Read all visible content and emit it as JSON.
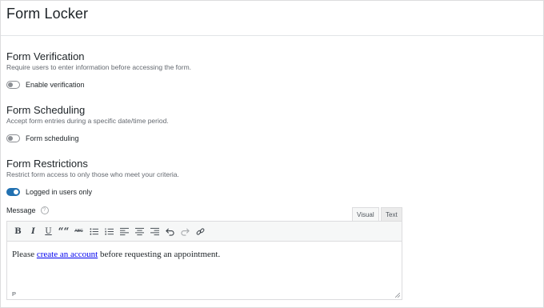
{
  "page": {
    "title": "Form Locker"
  },
  "sections": [
    {
      "title": "Form Verification",
      "description": "Require users to enter information before accessing the form.",
      "toggle_label": "Enable verification",
      "toggle_on": false
    },
    {
      "title": "Form Scheduling",
      "description": "Accept form entries during a specific date/time period.",
      "toggle_label": "Form scheduling",
      "toggle_on": false
    },
    {
      "title": "Form Restrictions",
      "description": "Restrict form access to only those who meet your criteria.",
      "toggle_label": "Logged in users only",
      "toggle_on": true
    }
  ],
  "message": {
    "label": "Message",
    "help_glyph": "?",
    "tabs": {
      "visual": "Visual",
      "text": "Text"
    },
    "toolbar": [
      {
        "name": "bold-icon",
        "glyph": "B"
      },
      {
        "name": "italic-icon",
        "glyph": "I"
      },
      {
        "name": "underline-icon",
        "glyph": "U"
      },
      {
        "name": "blockquote-icon",
        "glyph": "““"
      },
      {
        "name": "strikethrough-icon",
        "glyph": "ABC"
      },
      {
        "name": "bullet-list-icon",
        "glyph": ""
      },
      {
        "name": "numbered-list-icon",
        "glyph": ""
      },
      {
        "name": "align-left-icon",
        "glyph": ""
      },
      {
        "name": "align-center-icon",
        "glyph": ""
      },
      {
        "name": "align-right-icon",
        "glyph": ""
      },
      {
        "name": "undo-icon",
        "glyph": ""
      },
      {
        "name": "redo-icon",
        "glyph": ""
      },
      {
        "name": "link-icon",
        "glyph": ""
      }
    ],
    "content": {
      "before": "Please ",
      "link_text": "create an account",
      "after": " before requesting an appointment."
    },
    "status_path": "P"
  },
  "colors": {
    "accent": "#2271b1",
    "link": "#0000ee",
    "border": "#dcdcde"
  }
}
